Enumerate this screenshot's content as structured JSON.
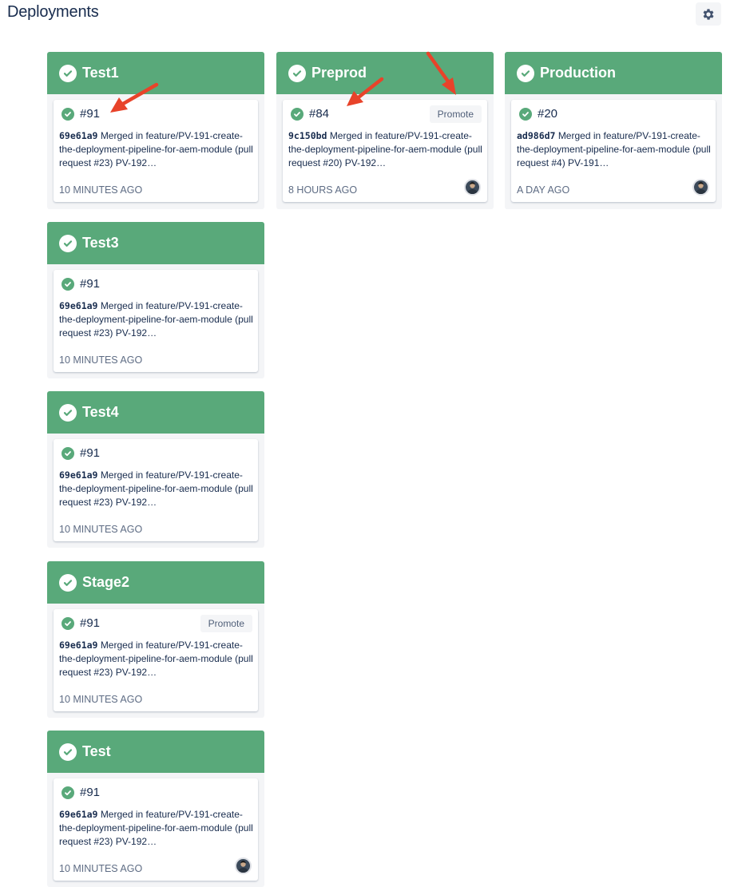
{
  "page": {
    "title": "Deployments"
  },
  "toolbar": {
    "settings_icon": "gear-icon"
  },
  "environments": [
    {
      "name": "Test1",
      "build": "#91",
      "hash": "69e61a9",
      "message": "Merged in feature/PV-191-create-the-deployment-pipeline-for-aem-module (pull request #23) PV-192…",
      "time": "10 MINUTES AGO"
    },
    {
      "name": "Preprod",
      "build": "#84",
      "hash": "9c150bd",
      "message": "Merged in feature/PV-191-create-the-deployment-pipeline-for-aem-module (pull request #20) PV-192…",
      "time": "8 HOURS AGO",
      "promote": "Promote"
    },
    {
      "name": "Production",
      "build": "#20",
      "hash": "ad986d7",
      "message": "Merged in feature/PV-191-create-the-deployment-pipeline-for-aem-module (pull request #4) PV-191…",
      "time": "A DAY AGO"
    },
    {
      "name": "Test3",
      "build": "#91",
      "hash": "69e61a9",
      "message": "Merged in feature/PV-191-create-the-deployment-pipeline-for-aem-module (pull request #23) PV-192…",
      "time": "10 MINUTES AGO"
    },
    {
      "name": "Test4",
      "build": "#91",
      "hash": "69e61a9",
      "message": "Merged in feature/PV-191-create-the-deployment-pipeline-for-aem-module (pull request #23) PV-192…",
      "time": "10 MINUTES AGO"
    },
    {
      "name": "Stage2",
      "build": "#91",
      "hash": "69e61a9",
      "message": "Merged in feature/PV-191-create-the-deployment-pipeline-for-aem-module (pull request #23) PV-192…",
      "time": "10 MINUTES AGO",
      "promote": "Promote"
    },
    {
      "name": "Test",
      "build": "#91",
      "hash": "69e61a9",
      "message": "Merged in feature/PV-191-create-the-deployment-pipeline-for-aem-module (pull request #23) PV-192…",
      "time": "10 MINUTES AGO"
    }
  ],
  "colors": {
    "success": "#59a97a",
    "annotation_arrow": "#e8432a"
  }
}
